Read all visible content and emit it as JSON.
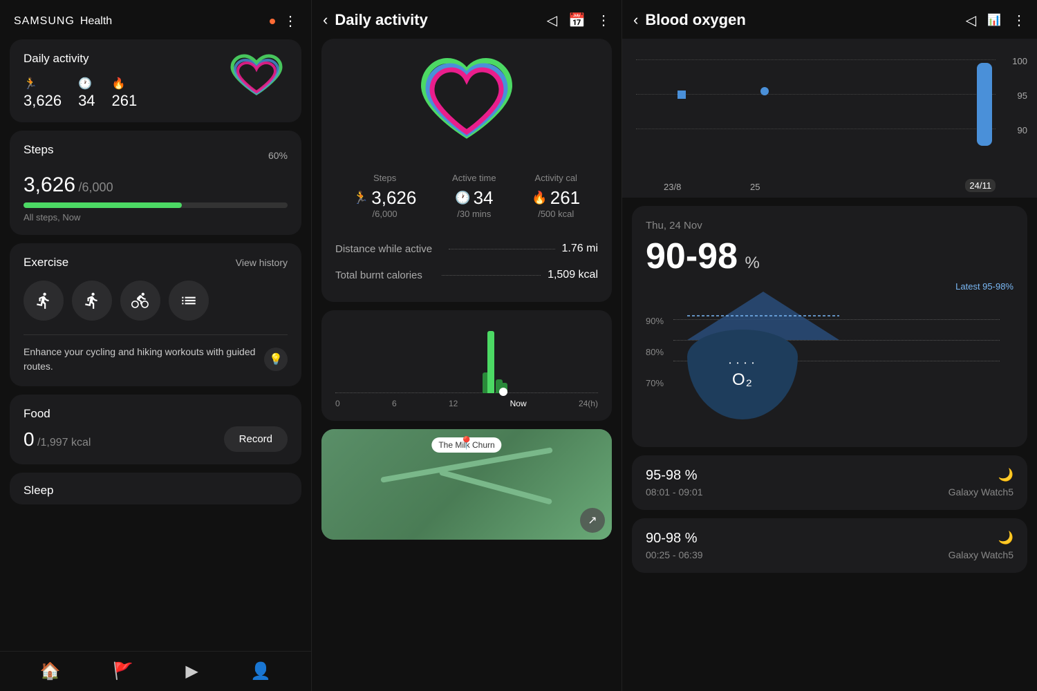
{
  "left": {
    "brand": "SAMSUNG",
    "health": "Health",
    "menu_dots": "⋮",
    "daily_activity": {
      "title": "Daily activity",
      "steps_value": "3,626",
      "active_time": "34",
      "calories": "261"
    },
    "steps": {
      "title": "Steps",
      "value": "3,626",
      "goal": "/6,000",
      "percent": "60%",
      "sub": "All steps, Now",
      "fill_width": "60"
    },
    "exercise": {
      "title": "Exercise",
      "view_history": "View history",
      "promo": "Enhance your cycling and hiking workouts with guided routes."
    },
    "food": {
      "title": "Food",
      "calories": "0",
      "goal": "/1,997 kcal",
      "record_btn": "Record"
    },
    "sleep": {
      "title": "Sleep"
    }
  },
  "middle": {
    "header": {
      "title": "Daily activity",
      "back": "‹",
      "share_icon": "◁",
      "calendar_icon": "📅",
      "dots": "⋮"
    },
    "metrics": {
      "steps": {
        "label": "Steps",
        "value": "3,626",
        "goal": "/6,000"
      },
      "active_time": {
        "label": "Active time",
        "value": "34",
        "goal": "/30 mins"
      },
      "activity_cal": {
        "label": "Activity cal",
        "value": "261",
        "goal": "/500 kcal"
      }
    },
    "details": {
      "distance_label": "Distance while active",
      "distance_value": "1.76 mi",
      "calories_label": "Total burnt calories",
      "calories_value": "1,509 kcal"
    },
    "chart": {
      "labels": [
        "0",
        "6",
        "12",
        "Now",
        "24(h)"
      ]
    },
    "map": {
      "place": "The Milk Churn"
    }
  },
  "right": {
    "header": {
      "title": "Blood oxygen",
      "back": "‹",
      "share": "◁",
      "chart": "📊",
      "dots": "⋮"
    },
    "graph": {
      "y_labels": [
        "100",
        "95",
        "90"
      ],
      "x_labels": [
        "23/8",
        "25",
        "24/11"
      ]
    },
    "main_reading": {
      "date": "Thu, 24 Nov",
      "range": "90-98",
      "unit": "%",
      "latest_label": "Latest 95-98%",
      "y_ticks": [
        "90%",
        "80%",
        "70%"
      ]
    },
    "readings": [
      {
        "range": "95-98 %",
        "time": "08:01 - 09:01",
        "device": "Galaxy Watch5",
        "moon": "🌙"
      },
      {
        "range": "90-98 %",
        "time": "00:25 - 06:39",
        "device": "Galaxy Watch5",
        "moon": "🌙"
      }
    ]
  },
  "nav": {
    "items": [
      "🏠",
      "🚩",
      "▶",
      "👤"
    ]
  }
}
